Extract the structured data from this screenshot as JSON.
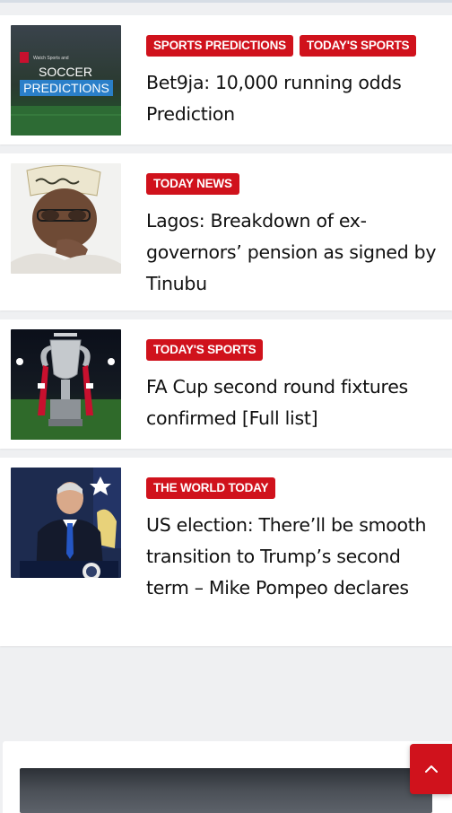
{
  "articles": [
    {
      "categories": [
        "SPORTS PREDICTIONS",
        "TODAY'S SPORTS"
      ],
      "title": "Bet9ja: 10,000 running odds Prediction",
      "thumb_text": {
        "small": "Watch Sports and",
        "line1": "SOCCER",
        "line2": "PREDICTIONS"
      }
    },
    {
      "categories": [
        "TODAY NEWS"
      ],
      "title": "Lagos: Breakdown of ex-governors’ pension as signed by Tinubu"
    },
    {
      "categories": [
        "TODAY'S SPORTS"
      ],
      "title": "FA Cup second round fixtures confirmed [Full list]"
    },
    {
      "categories": [
        "THE WORLD TODAY"
      ],
      "title": "US election: There’ll be smooth transition to Trump’s second term – Mike Pompeo declares"
    }
  ],
  "scroll_top": {
    "icon": "chevron-up-icon"
  },
  "colors": {
    "accent": "#d0121c",
    "background": "#eff0f2",
    "card": "#ffffff"
  }
}
